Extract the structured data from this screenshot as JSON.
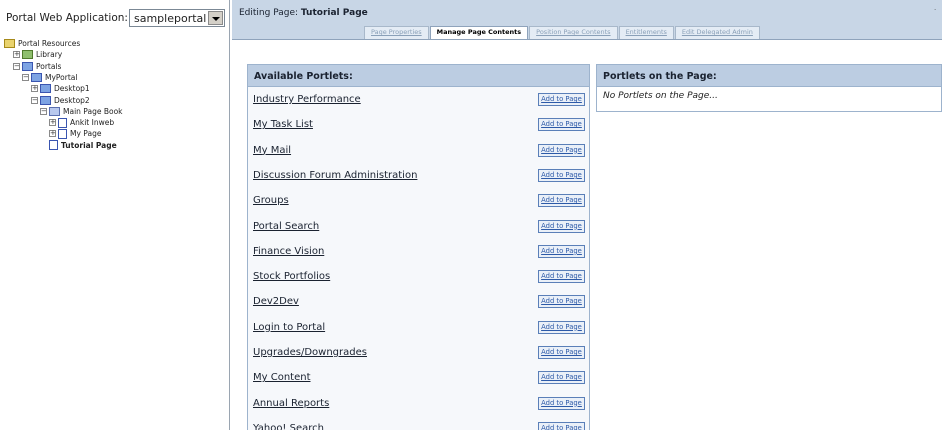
{
  "sidebar": {
    "app_label": "Portal Web Application:",
    "app_select_value": "sampleportal",
    "tree": [
      {
        "label": "Portal Resources",
        "icon": "portal-resources-icon",
        "indent": 0,
        "expander": ""
      },
      {
        "label": "Library",
        "icon": "library-icon",
        "indent": 1,
        "expander": "+"
      },
      {
        "label": "Portals",
        "icon": "portals-icon",
        "indent": 1,
        "expander": "−"
      },
      {
        "label": "MyPortal",
        "icon": "portal-icon",
        "indent": 2,
        "expander": "−"
      },
      {
        "label": "Desktop1",
        "icon": "desktop-icon",
        "indent": 3,
        "expander": "+"
      },
      {
        "label": "Desktop2",
        "icon": "desktop-icon",
        "indent": 3,
        "expander": "−"
      },
      {
        "label": "Main Page Book",
        "icon": "book-icon",
        "indent": 4,
        "expander": "−"
      },
      {
        "label": "Ankit Inweb",
        "icon": "page-icon",
        "indent": 5,
        "expander": "+"
      },
      {
        "label": "My Page",
        "icon": "page-icon",
        "indent": 5,
        "expander": "+"
      },
      {
        "label": "Tutorial Page",
        "icon": "page-icon",
        "indent": 5,
        "expander": "",
        "selected": true
      }
    ]
  },
  "editing": {
    "prefix": "Editing Page:",
    "page_name": "Tutorial Page"
  },
  "tabs": [
    {
      "label": "Page Properties",
      "active": false
    },
    {
      "label": "Manage Page Contents",
      "active": true
    },
    {
      "label": "Position Page Contents",
      "active": false
    },
    {
      "label": "Entitlements",
      "active": false
    },
    {
      "label": "Edit Delegated Admin",
      "active": false
    }
  ],
  "available": {
    "header": "Available Portlets:",
    "add_label": "Add to Page",
    "portlets": [
      "Industry Performance",
      "My Task List",
      "My Mail",
      "Discussion Forum Administration",
      "Groups",
      "Portal Search",
      "Finance Vision",
      "Stock Portfolios",
      "Dev2Dev",
      "Login to Portal",
      "Upgrades/Downgrades",
      "My Content",
      "Annual Reports",
      "Yahoo! Search"
    ]
  },
  "on_page": {
    "header": "Portlets on the Page:",
    "empty_text": "No Portlets on the Page..."
  }
}
